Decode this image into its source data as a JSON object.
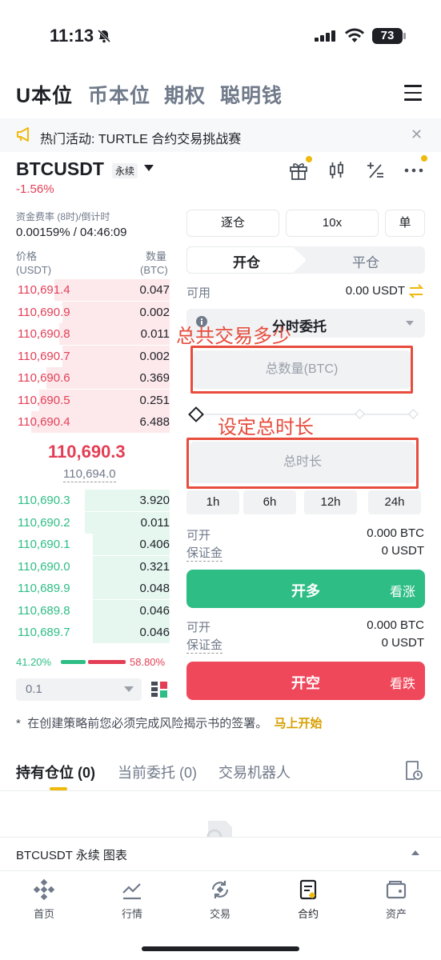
{
  "status": {
    "time": "11:13",
    "battery": "73"
  },
  "nav": {
    "tabs": [
      "U本位",
      "币本位",
      "期权",
      "聪明钱"
    ]
  },
  "banner": {
    "text": "热门活动: TURTLE 合约交易挑战赛"
  },
  "symbol": {
    "name": "BTCUSDT",
    "type": "永续",
    "change": "-1.56%"
  },
  "funding": {
    "label": "资金费率 (8时)/倒计时",
    "value": "0.00159% / 04:46:09"
  },
  "book": {
    "price_label": "价格",
    "price_unit": "(USDT)",
    "qty_label": "数量",
    "qty_unit": "(BTC)",
    "asks": [
      {
        "p": "110,691.4",
        "q": "0.047",
        "d": 0.75
      },
      {
        "p": "110,690.9",
        "q": "0.002",
        "d": 0.7
      },
      {
        "p": "110,690.8",
        "q": "0.011",
        "d": 0.72
      },
      {
        "p": "110,690.7",
        "q": "0.002",
        "d": 0.7
      },
      {
        "p": "110,690.6",
        "q": "0.369",
        "d": 0.8
      },
      {
        "p": "110,690.5",
        "q": "0.251",
        "d": 0.85
      },
      {
        "p": "110,690.4",
        "q": "6.488",
        "d": 0.9
      }
    ],
    "mid": "110,690.3",
    "mark": "110,694.0",
    "bids": [
      {
        "p": "110,690.3",
        "q": "3.920",
        "d": 0.55
      },
      {
        "p": "110,690.2",
        "q": "0.011",
        "d": 0.55
      },
      {
        "p": "110,690.1",
        "q": "0.406",
        "d": 0.5
      },
      {
        "p": "110,690.0",
        "q": "0.321",
        "d": 0.5
      },
      {
        "p": "110,689.9",
        "q": "0.048",
        "d": 0.5
      },
      {
        "p": "110,689.8",
        "q": "0.046",
        "d": 0.5
      },
      {
        "p": "110,689.7",
        "q": "0.046",
        "d": 0.5
      }
    ],
    "buy_pct": "41.20%",
    "sell_pct": "58.80%",
    "buy_ratio": 0.412,
    "precision": "0.1"
  },
  "order": {
    "margin_mode": "逐仓",
    "leverage": "10x",
    "position_mode": "单",
    "tab_open": "开仓",
    "tab_close": "平仓",
    "available_label": "可用",
    "available_value": "0.00 USDT",
    "order_type": "分时委托",
    "total_qty_placeholder": "总数量(BTC)",
    "total_time_placeholder": "总时长",
    "durations": [
      "1h",
      "6h",
      "12h",
      "24h"
    ],
    "long": {
      "can_open_label": "可开",
      "can_open": "0.000 BTC",
      "margin_label": "保证金",
      "margin": "0 USDT",
      "button": "开多",
      "sub": "看涨"
    },
    "short": {
      "can_open_label": "可开",
      "can_open": "0.000 BTC",
      "margin_label": "保证金",
      "margin": "0 USDT",
      "button": "开空",
      "sub": "看跌"
    }
  },
  "annotations": {
    "qty": "总共交易多少",
    "time": "设定总时长"
  },
  "notice": {
    "prefix": "*",
    "text": "在创建策略前您必须完成风险揭示书的签署。",
    "link": "马上开始"
  },
  "bottom_tabs": [
    "持有仓位 (0)",
    "当前委托 (0)",
    "交易机器人"
  ],
  "footer": {
    "text": "BTCUSDT 永续  图表"
  },
  "tabbar": [
    "首页",
    "行情",
    "交易",
    "合约",
    "资产"
  ],
  "colors": {
    "up": "#2ebd85",
    "down": "#e33e55",
    "accent": "#f0b90b"
  }
}
